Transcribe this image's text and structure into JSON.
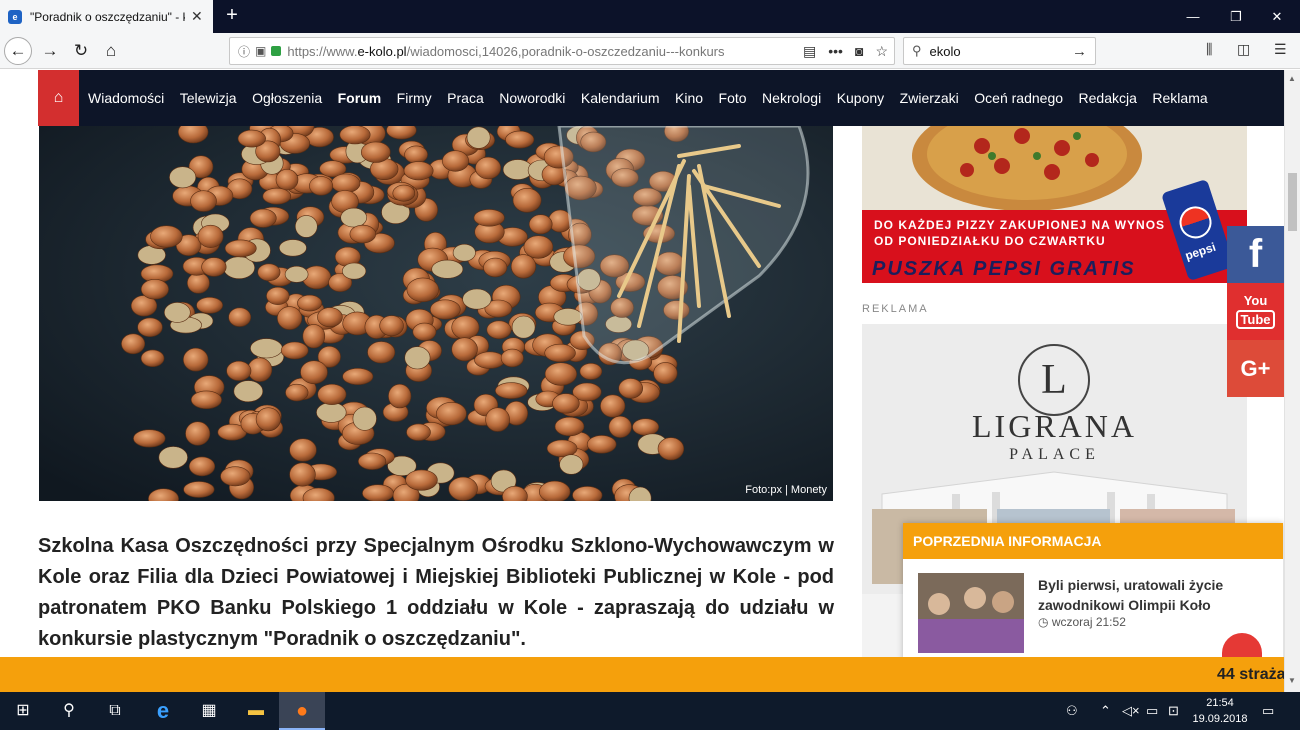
{
  "browser": {
    "tab_title": "\"Poradnik o oszczędzaniu\" - ko",
    "url_prefix": "https://www.",
    "url_domain": "e-kolo.pl",
    "url_rest": "/wiadomosci,14026,poradnik-o-oszczedzaniu---konkurs",
    "search_value": "ekolo",
    "more_glyph": "•••"
  },
  "site_nav": {
    "home_icon": "home-icon",
    "items": [
      {
        "label": "Wiadomości"
      },
      {
        "label": "Telewizja"
      },
      {
        "label": "Ogłoszenia"
      },
      {
        "label": "Forum"
      },
      {
        "label": "Firmy"
      },
      {
        "label": "Praca"
      },
      {
        "label": "Noworodki"
      },
      {
        "label": "Kalendarium"
      },
      {
        "label": "Kino"
      },
      {
        "label": "Foto"
      },
      {
        "label": "Nekrologi"
      },
      {
        "label": "Kupony"
      },
      {
        "label": "Zwierzaki"
      },
      {
        "label": "Oceń radnego"
      },
      {
        "label": "Redakcja"
      },
      {
        "label": "Reklama"
      }
    ]
  },
  "article": {
    "photo_caption": "Foto:px | Monety",
    "lead": "Szkolna Kasa Oszczędności przy Specjalnym Ośrodku Szklono-Wychowawczym w Kole oraz Filia dla Dzieci Powiatowej i Miejskiej Biblioteki Publicznej w Kole - pod patronatem PKO Banku Polskiego 1 oddziału w Kole - zapraszają do udziału w konkursie plastycznym \"Poradnik o oszczędzaniu\"."
  },
  "sidebar": {
    "pizza_ad": {
      "line1": "DO KAŻDEJ PIZZY ZAKUPIONEJ NA WYNOS",
      "line2": "OD PONIEDZIAŁKU DO CZWARTKU",
      "promo": "PUSZKA PEPSI GRATIS",
      "brand": "pepsi"
    },
    "reklama_label": "REKLAMA",
    "ligrana_ad": {
      "monogram": "L",
      "name": "LIGRANA",
      "subtitle": "PALACE"
    },
    "social": {
      "facebook": "f",
      "youtube_top": "You",
      "youtube_bottom": "Tube",
      "googleplus": "G+"
    }
  },
  "prev_info": {
    "header": "POPRZEDNIA INFORMACJA",
    "title": "Byli pierwsi, uratowali życie zawodnikowi Olimpii Koło",
    "time": "wczoraj 21:52"
  },
  "ticker": {
    "text": "44 straża"
  },
  "taskbar": {
    "time": "21:54",
    "date": "19.09.2018"
  },
  "colors": {
    "nav_bg": "#0d1528",
    "home_red": "#d32f2f",
    "accent_orange": "#f5a00c",
    "facebook": "#3b5998",
    "youtube": "#e02f2f",
    "googleplus": "#dd4b39"
  }
}
